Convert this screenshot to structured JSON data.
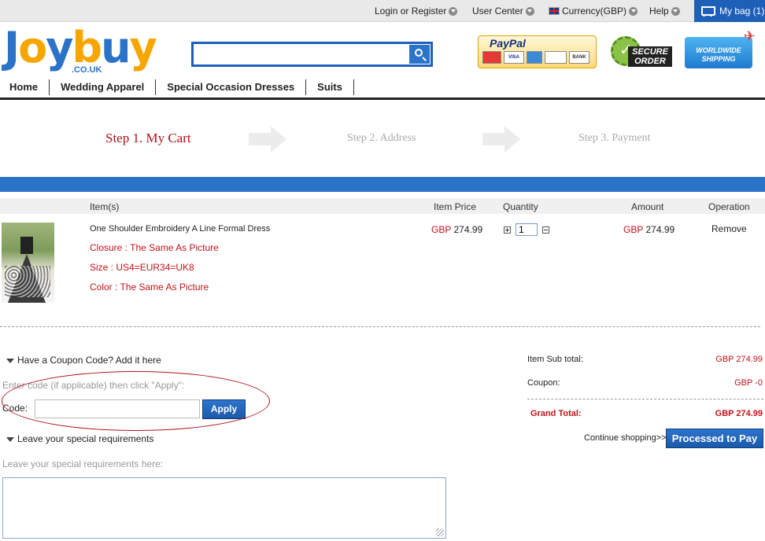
{
  "topbar": {
    "login": "Login or Register",
    "user_center": "User Center",
    "currency": "Currency(GBP)",
    "help": "Help",
    "bag": "My bag (1)"
  },
  "header": {
    "logo_letters": [
      "J",
      "o",
      "y",
      "b",
      "u",
      "y"
    ],
    "logo_tld": ".CO.UK",
    "search_placeholder": "",
    "paypal": "PayPal",
    "cards": [
      "MasterCard",
      "VISA",
      "AMEX",
      "DISCOVER",
      "BANK"
    ],
    "secure_badge": "SECURE ORDER",
    "worldwide_badge": "WORLDWIDE SHIPPING"
  },
  "nav": {
    "items": [
      "Home",
      "Wedding Apparel",
      "Special Occasion Dresses",
      "Suits"
    ]
  },
  "steps": {
    "step1": "Step 1. My Cart",
    "step2": "Step 2. Address",
    "step3": "Step 3. Payment"
  },
  "table": {
    "headers": {
      "items": "Item(s)",
      "price": "Item Price",
      "quantity": "Quantity",
      "amount": "Amount",
      "operation": "Operation"
    },
    "item": {
      "name": "One Shoulder Embroidery A Line Formal Dress",
      "closure": "Closure : The Same As Picture",
      "size": "Size : US4=EUR34=UK8",
      "color": "Color : The Same As Picture",
      "price_currency": "GBP",
      "price_value": "274.99",
      "quantity": "1",
      "amount_currency": "GBP",
      "amount_value": "274.99",
      "remove": "Remove"
    }
  },
  "coupon": {
    "heading": "Have a Coupon Code? Add it here",
    "hint": "Enter code (if applicable) then click \"Apply\":",
    "code_label": "Code:",
    "code_value": "",
    "apply": "Apply"
  },
  "requirements": {
    "heading": "Leave your special requirements",
    "hint": "Leave your special requirements here:",
    "value": ""
  },
  "totals": {
    "subtotal_label": "Item Sub total:",
    "subtotal_value": "GBP  274.99",
    "coupon_label": "Coupon:",
    "coupon_value": "GBP  -0",
    "grand_label": "Grand Total:",
    "grand_value": "GBP  274.99",
    "continue": "Continue shopping>>",
    "pay": "Processed to Pay"
  },
  "colors": {
    "brand_blue": "#2a73c9",
    "accent_red": "#c0131b",
    "logo_orange": "#f7a600"
  }
}
